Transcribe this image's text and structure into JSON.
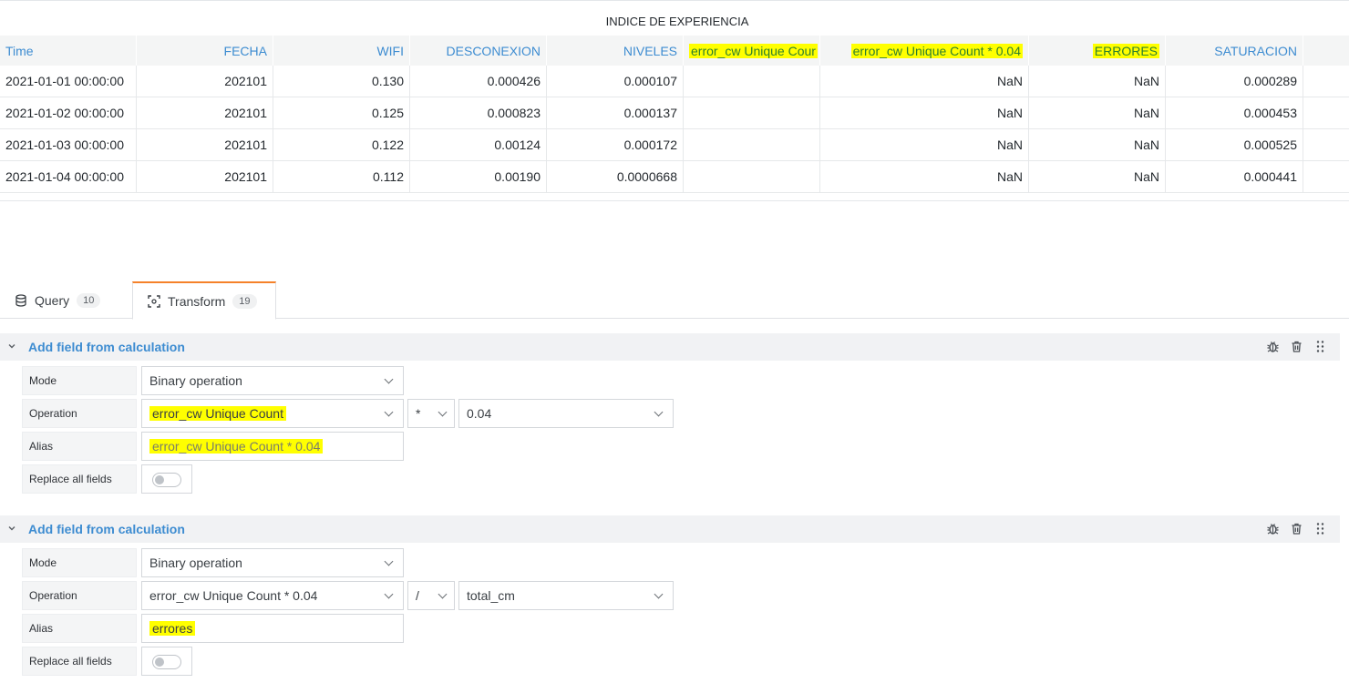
{
  "panel": {
    "title": "INDICE DE EXPERIENCIA",
    "columns": [
      "Time",
      "FECHA",
      "WIFI",
      "DESCONEXION",
      "NIVELES",
      "error_cw Unique Cour",
      "error_cw Unique Count * 0.04",
      "ERRORES",
      "SATURACION"
    ],
    "rows": [
      [
        "2021-01-01 00:00:00",
        "202101",
        "0.130",
        "0.000426",
        "0.000107",
        "",
        "NaN",
        "NaN",
        "0.000289"
      ],
      [
        "2021-01-02 00:00:00",
        "202101",
        "0.125",
        "0.000823",
        "0.000137",
        "",
        "NaN",
        "NaN",
        "0.000453"
      ],
      [
        "2021-01-03 00:00:00",
        "202101",
        "0.122",
        "0.00124",
        "0.000172",
        "",
        "NaN",
        "NaN",
        "0.000525"
      ],
      [
        "2021-01-04 00:00:00",
        "202101",
        "0.112",
        "0.00190",
        "0.0000668",
        "",
        "NaN",
        "NaN",
        "0.000441"
      ]
    ],
    "highlight_color": "#ffff00"
  },
  "tabs": [
    {
      "label": "Query",
      "count": "10",
      "icon": "database-icon"
    },
    {
      "label": "Transform",
      "count": "19",
      "icon": "transform-icon",
      "active": true
    }
  ],
  "transformations": [
    {
      "title": "Add field from calculation",
      "mode_label": "Mode",
      "mode_value": "Binary operation",
      "operation_label": "Operation",
      "operation_left": "error_cw Unique Count",
      "operator": "*",
      "operation_right": "0.04",
      "alias_label": "Alias",
      "alias_value": "error_cw Unique Count * 0.04",
      "replace_label": "Replace all fields",
      "replace_on": false
    },
    {
      "title": "Add field from calculation",
      "mode_label": "Mode",
      "mode_value": "Binary operation",
      "operation_label": "Operation",
      "operation_left": "error_cw Unique Count * 0.04",
      "operator": "/",
      "operation_right": "total_cm",
      "alias_label": "Alias",
      "alias_value": "errores",
      "replace_label": "Replace all fields",
      "replace_on": false
    }
  ],
  "colors": {
    "accent": "#3d8cd1",
    "tab_active_border": "#f5822a"
  }
}
